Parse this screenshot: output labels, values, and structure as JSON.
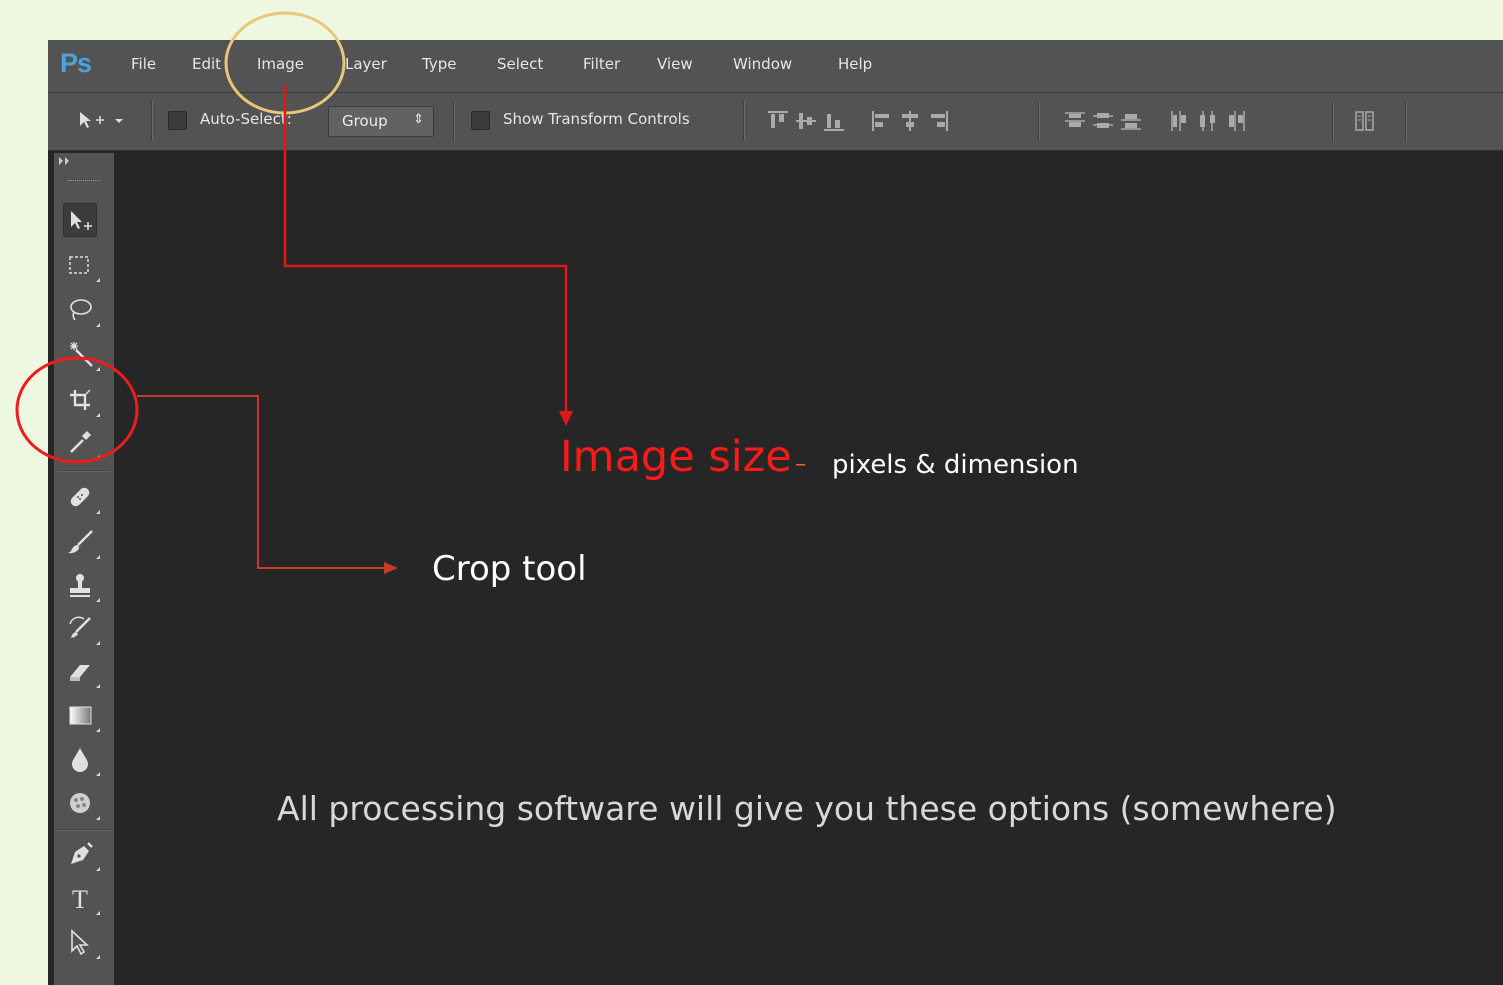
{
  "app": {
    "logo": "Ps"
  },
  "menu": [
    "File",
    "Edit",
    "Image",
    "Layer",
    "Type",
    "Select",
    "Filter",
    "View",
    "Window",
    "Help"
  ],
  "options_bar": {
    "auto_select_label": "Auto-Select:",
    "group_value": "Group",
    "group_arrow": "⇕",
    "show_transform_label": "Show Transform Controls"
  },
  "tools": [
    "move-tool",
    "marquee-tool",
    "lasso-tool",
    "magic-wand-tool",
    "crop-tool",
    "eyedropper-tool",
    "healing-brush-tool",
    "brush-tool",
    "clone-stamp-tool",
    "history-brush-tool",
    "eraser-tool",
    "gradient-tool",
    "blur-tool",
    "dodge-tool",
    "pen-tool",
    "type-tool",
    "path-selection-tool"
  ],
  "annotations": {
    "image_size_title": "Image size",
    "image_size_dash": "–",
    "image_size_sub": "pixels & dimension",
    "crop_label": "Crop tool",
    "footer_note": "All processing software will give you these options (somewhere)"
  },
  "colors": {
    "annotation_red": "#ff1a1a",
    "highlight_circle": "#e8c878",
    "crop_circle": "#ee1c1c",
    "arrow_image": "#e21818",
    "arrow_crop": "#c83a26",
    "ps_blue": "#4aa3df"
  }
}
